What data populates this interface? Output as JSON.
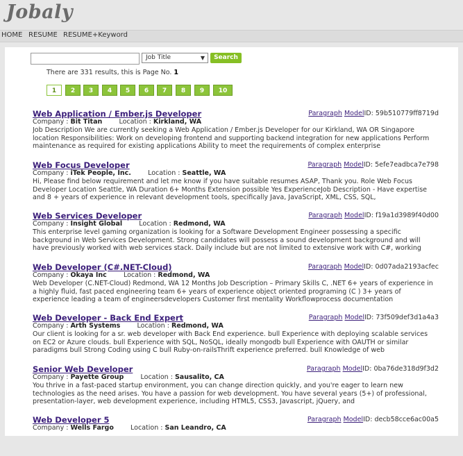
{
  "brand": "Jobaly",
  "nav": [
    "HOME",
    "RESUME",
    "RESUME+Keyword"
  ],
  "search": {
    "value": "",
    "select_value": "Job Title",
    "button": "Search"
  },
  "results": {
    "prefix": "There are 331 results, this is Page No.",
    "page": "1"
  },
  "pages": [
    "1",
    "2",
    "3",
    "4",
    "5",
    "6",
    "7",
    "8",
    "9",
    "10"
  ],
  "labels": {
    "paragraph": "Paragraph",
    "model": "Model",
    "id": "ID:",
    "company": "Company :",
    "location": "Location :"
  },
  "jobs": [
    {
      "title": "Web Application / Ember.js Developer",
      "company": "Bit Titan",
      "location": "Kirkland, WA",
      "id": "59b510779ff8719d",
      "desc": "Job Description We are currently seeking a Web Application / Ember.js Developer for our Kirkland, WA OR Singapore location Responsibilities: Work on developing frontend and supporting backend integration for new applications Perform maintenance as required for existing applications Ability to meet the requirements of complex enterprise"
    },
    {
      "title": "Web Focus Developer",
      "company": "iTek People, Inc.",
      "location": "Seattle, WA",
      "id": "5efe7eadbca7e798",
      "desc": "Hi, Please find below requirement and let me know if you have suitable resumes ASAP, Thank you. Role Web Focus Developer Location Seattle, WA Duration 6+ Months Extension possible Yes ExperienceJob Description - Have expertise and 8 + years of experience in relevant development tools, specifically Java, JavaScript, XML, CSS, SQL,"
    },
    {
      "title": "Web Services Developer",
      "company": "Insight Global",
      "location": "Redmond, WA",
      "id": "f19a1d3989f40d00",
      "desc": "This enterprise level gaming organization is looking for a Software Development Engineer possessing a specific background in Web Services Development. Strong candidates will possess a sound development background and will have previously worked with web services stack. Daily include but are not limited to extensive work with C#, working"
    },
    {
      "title": "Web Developer (C#.NET-Cloud)",
      "company": "Okaya Inc",
      "location": "Redmond, WA",
      "id": "0d07ada2193acfec",
      "desc": "Web Developer (C.NET-Cloud) Redmond, WA 12 Months Job Description – Primary Skills C, .NET 6+ years of experience in a highly fluid, fast paced engineering team 6+ years of experience object oriented programing (C ) 3+ years of experience leading a team of engineersdevelopers Customer first mentality Workflowprocess documentation"
    },
    {
      "title": "Web Developer - Back End Expert",
      "company": "Arth Systems",
      "location": "Redmond, WA",
      "id": "73f509def3d1a4a3",
      "desc": "Our client is looking for a sr. web developer with Back End experience. bull Experience with deploying scalable services on EC2 or Azure clouds. bull Experience with SQL, NoSQL, ideally mongodb bull Experience with OAUTH or similar paradigms bull Strong Coding using C bull Ruby-on-railsThrift experience preferred. bull Knowledge of web"
    },
    {
      "title": "Senior Web Developer",
      "company": "Payette Group",
      "location": "Sausalito, CA",
      "id": "0ba76de318d9f3d2",
      "desc": "You thrive in a fast-paced startup environment, you can change direction quickly, and you're eager to learn new technologies as the need arises. You have a passion for web development. You have several years (5+) of professional, presentation-layer, web development experience, including HTML5, CSS3, Javascript, jQuery, and"
    },
    {
      "title": "Web Developer 5",
      "company": "Wells Fargo",
      "location": "San Leandro, CA",
      "id": "decb58cce6ac00a5",
      "desc": ""
    }
  ]
}
